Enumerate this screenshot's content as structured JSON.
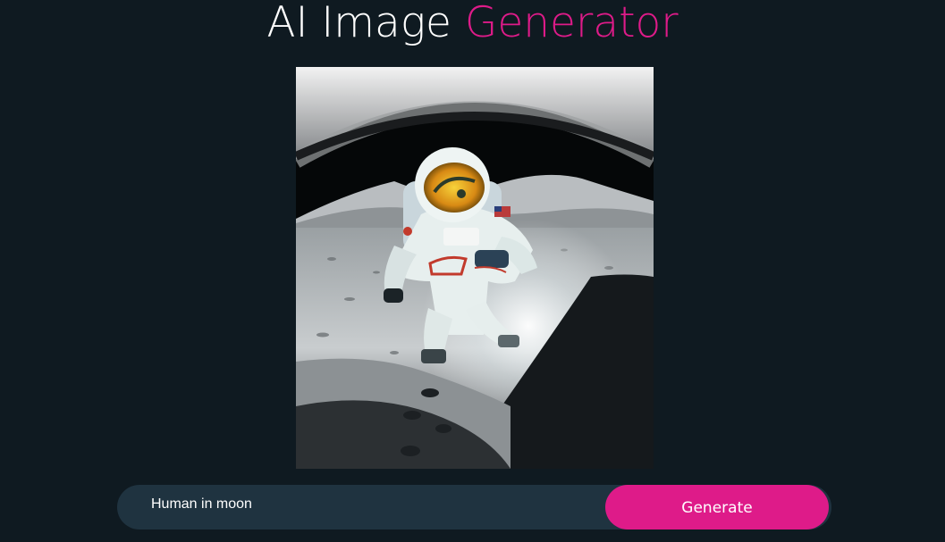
{
  "header": {
    "title_main": "AI Image",
    "title_accent": "Generator"
  },
  "generated_image": {
    "subject": "astronaut on the moon"
  },
  "prompt": {
    "value": "Human in moon",
    "button_label": "Generate"
  },
  "colors": {
    "background": "#0f1a21",
    "accent": "#de1b89",
    "input_bg": "#1f3340",
    "text": "#ffffff"
  }
}
